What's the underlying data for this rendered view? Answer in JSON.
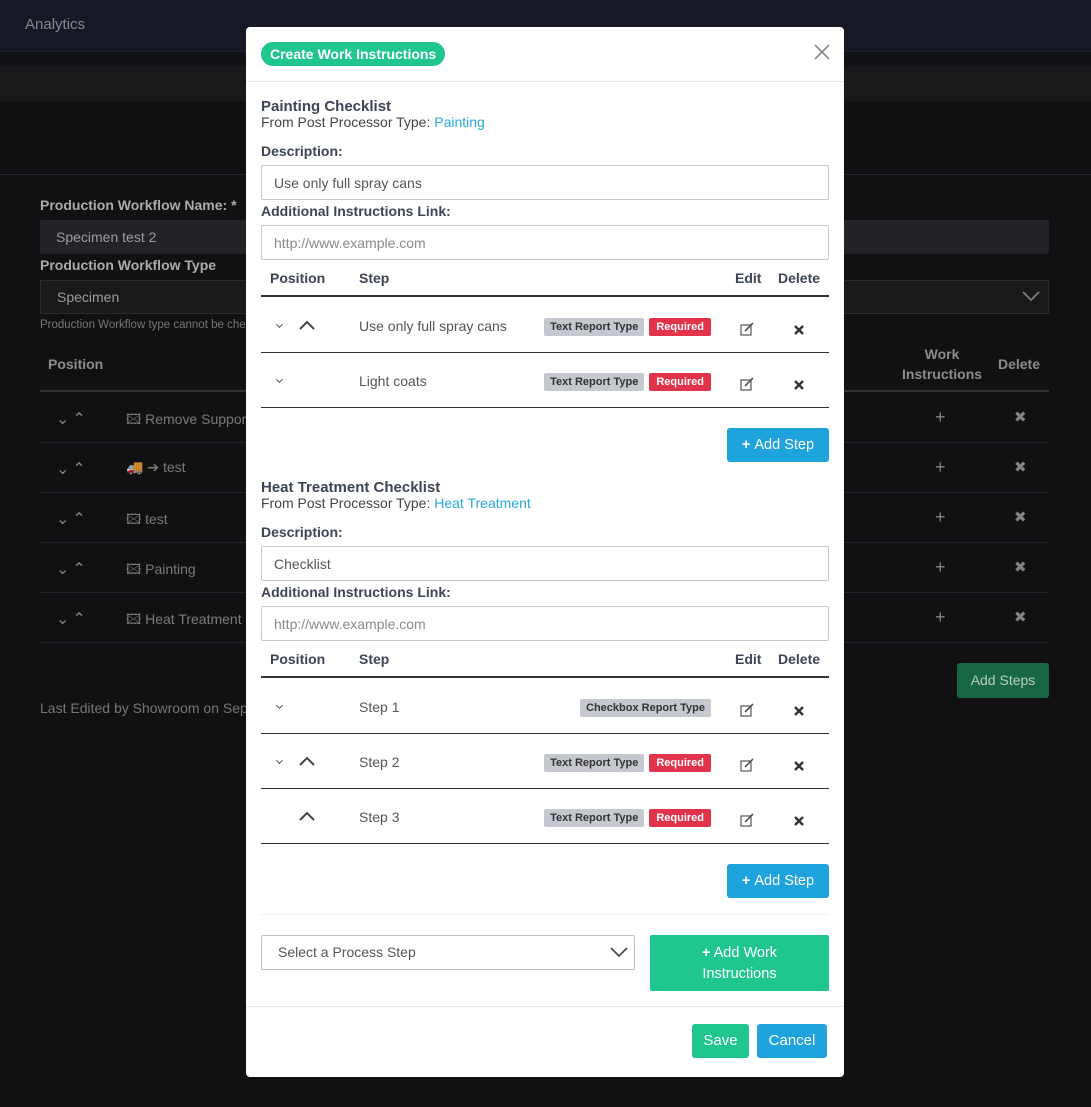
{
  "background": {
    "nav_brand": "Analytics",
    "workflow_name_label": "Production Workflow Name: *",
    "workflow_name_value": "Specimen test 2",
    "workflow_type_label": "Production Workflow Type",
    "workflow_type_value": "Specimen",
    "workflow_type_help": "Production Workflow type cannot be che",
    "table_headers": {
      "position": "Position",
      "work_instructions": "Work Instructions",
      "delete": "Delete"
    },
    "rows": [
      {
        "chevrons": "⌄⌃",
        "name": "🖾 Remove Support"
      },
      {
        "chevrons": "⌄⌃",
        "name": "🚚 ➔ test"
      },
      {
        "chevrons": "⌄⌃",
        "name": "🖾 test"
      },
      {
        "chevrons": "⌄⌃",
        "name": "🖾 Painting"
      },
      {
        "chevrons": "⌄⌃",
        "name": "🖾 Heat Treatment"
      }
    ],
    "row_plus": "+",
    "row_delete": "✖",
    "add_steps_label": "Add Steps",
    "footer_text": "Last Edited by Showroom on Septe"
  },
  "modal": {
    "title": "Create Work Instructions",
    "close_icon": "close-icon",
    "sections": [
      {
        "title": "Painting Checklist",
        "from_prefix": "From Post Processor Type: ",
        "from_link": "Painting",
        "description_label": "Description:",
        "description_value": "Use only full spray cans",
        "link_label": "Additional Instructions Link:",
        "link_placeholder": "http://www.example.com",
        "table_headers": {
          "position": "Position",
          "step": "Step",
          "edit": "Edit",
          "delete": "Delete"
        },
        "steps": [
          {
            "text": "Use only full spray cans",
            "report_type": "Text Report Type",
            "required": "Required"
          },
          {
            "text": "Light coats",
            "report_type": "Text Report Type",
            "required": "Required"
          }
        ],
        "add_step_label": "Add Step"
      },
      {
        "title": "Heat Treatment Checklist",
        "from_prefix": "From Post Processor Type: ",
        "from_link": "Heat Treatment",
        "description_label": "Description:",
        "description_value": "Checklist",
        "link_label": "Additional Instructions Link:",
        "link_placeholder": "http://www.example.com",
        "table_headers": {
          "position": "Position",
          "step": "Step",
          "edit": "Edit",
          "delete": "Delete"
        },
        "steps": [
          {
            "text": "Step 1",
            "report_type": "Checkbox Report Type",
            "required": ""
          },
          {
            "text": "Step 2",
            "report_type": "Text Report Type",
            "required": "Required"
          },
          {
            "text": "Step 3",
            "report_type": "Text Report Type",
            "required": "Required"
          }
        ],
        "add_step_label": "Add Step"
      }
    ],
    "process_select_placeholder": "Select a Process Step",
    "add_work_instructions_line1": "Add Work",
    "add_work_instructions_line2": "Instructions",
    "save_label": "Save",
    "cancel_label": "Cancel"
  },
  "colors": {
    "accent_green": "#1fc690",
    "accent_blue": "#1fa3dc",
    "required_red": "#e2334b",
    "link_blue": "#2aa8dc"
  }
}
